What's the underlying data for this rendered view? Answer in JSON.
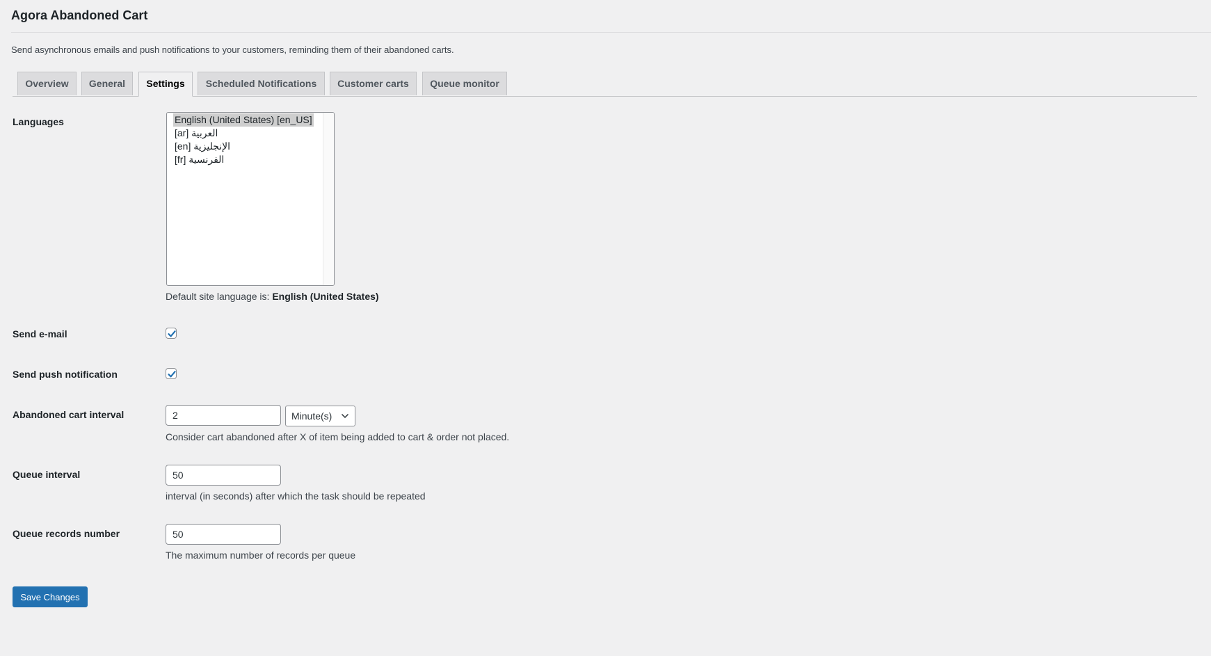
{
  "header": {
    "title": "Agora Abandoned Cart",
    "description": "Send asynchronous emails and push notifications to your customers, reminding them of their abandoned carts."
  },
  "tabs": [
    {
      "label": "Overview",
      "active": false
    },
    {
      "label": "General",
      "active": false
    },
    {
      "label": "Settings",
      "active": true
    },
    {
      "label": "Scheduled Notifications",
      "active": false
    },
    {
      "label": "Customer carts",
      "active": false
    },
    {
      "label": "Queue monitor",
      "active": false
    }
  ],
  "settings": {
    "languages": {
      "label": "Languages",
      "options": [
        {
          "label": "English (United States) [en_US]",
          "selected": true
        },
        {
          "label": "العربية [ar]",
          "selected": false
        },
        {
          "label": "الإنجليزية [en]",
          "selected": false
        },
        {
          "label": "الفرنسية [fr]",
          "selected": false
        }
      ],
      "default_prefix": "Default site language is: ",
      "default_value": "English (United States)"
    },
    "send_email": {
      "label": "Send e-mail",
      "checked": true
    },
    "send_push": {
      "label": "Send push notification",
      "checked": true
    },
    "abandoned_interval": {
      "label": "Abandoned cart interval",
      "value": "2",
      "unit": "Minute(s)",
      "hint": "Consider cart abandoned after X of item being added to cart & order not placed."
    },
    "queue_interval": {
      "label": "Queue interval",
      "value": "50",
      "hint": "interval (in seconds) after which the task should be repeated"
    },
    "queue_records": {
      "label": "Queue records number",
      "value": "50",
      "hint": "The maximum number of records per queue"
    }
  },
  "actions": {
    "save_label": "Save Changes"
  },
  "colors": {
    "accent": "#2271b1",
    "background": "#f0f0f1"
  }
}
